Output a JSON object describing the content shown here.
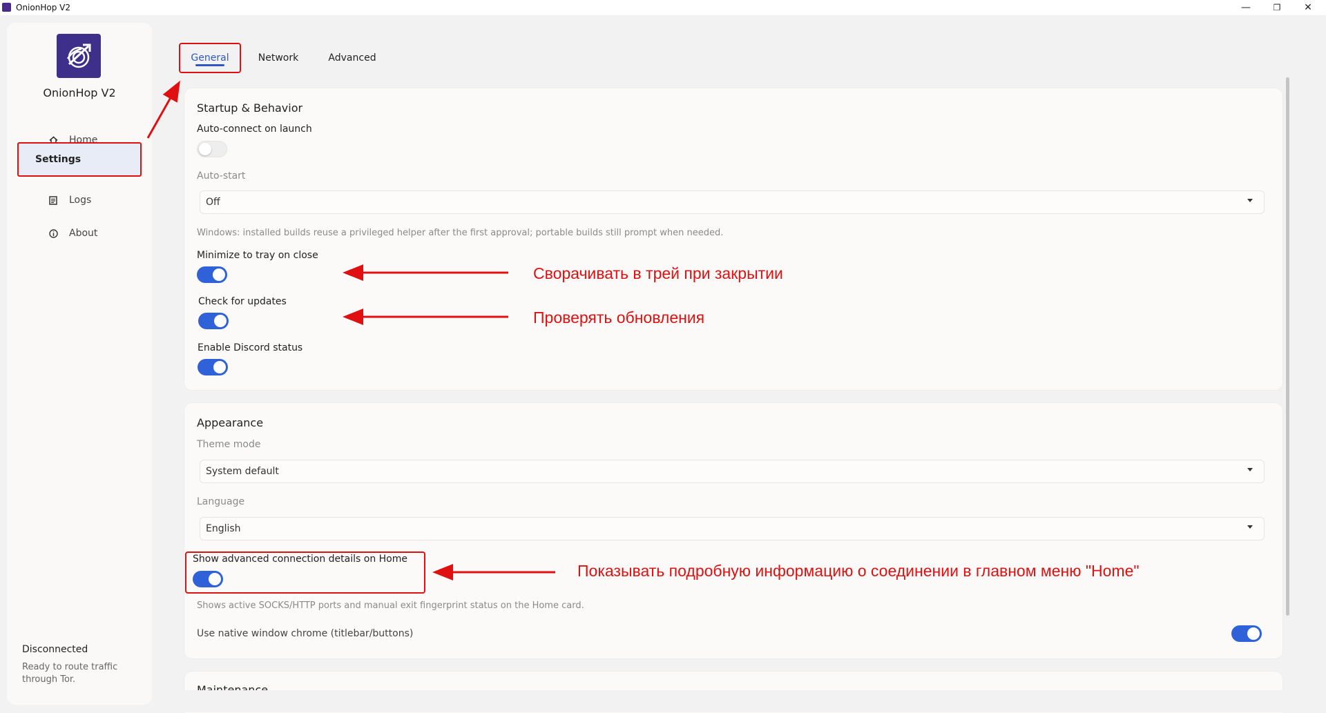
{
  "window": {
    "title": "OnionHop V2",
    "minimize": "—",
    "restore": "❐",
    "close": "✕"
  },
  "sidebar": {
    "brand": "OnionHop V2",
    "items": [
      {
        "label": "Home",
        "icon": "home-icon"
      },
      {
        "label": "Settings",
        "icon": ""
      },
      {
        "label": "Logs",
        "icon": "logs-icon"
      },
      {
        "label": "About",
        "icon": "info-icon"
      }
    ],
    "status_title": "Disconnected",
    "status_text": "Ready to route traffic through Tor."
  },
  "tabs": [
    {
      "label": "General",
      "active": true
    },
    {
      "label": "Network",
      "active": false
    },
    {
      "label": "Advanced",
      "active": false
    }
  ],
  "startup": {
    "title": "Startup & Behavior",
    "autoconnect_label": "Auto-connect on launch",
    "autoconnect_on": false,
    "autostart_label": "Auto-start",
    "autostart_value": "Off",
    "windows_hint": "Windows: installed builds reuse a privileged helper after the first approval; portable builds still prompt when needed.",
    "tray_label": "Minimize to tray on close",
    "tray_on": true,
    "updates_label": "Check for updates",
    "updates_on": true,
    "discord_label": "Enable Discord status",
    "discord_on": true
  },
  "appearance": {
    "title": "Appearance",
    "theme_label": "Theme mode",
    "theme_value": "System default",
    "language_label": "Language",
    "language_value": "English",
    "advanced_label": "Show advanced connection details on Home",
    "advanced_on": true,
    "advanced_hint": "Shows active SOCKS/HTTP ports and manual exit fingerprint status on the Home card.",
    "native_label": "Use native window chrome (titlebar/buttons)",
    "native_on": true
  },
  "maintenance": {
    "title": "Maintenance"
  },
  "annotations": {
    "tray_note": "Сворачивать в трей при закрытии",
    "updates_note": "Проверять обновления",
    "advanced_note": "Показывать подробную информацию о соединении в главном меню \"Home\""
  },
  "colors": {
    "accent": "#2f62d8",
    "annotation": "#e01010",
    "logo_bg": "#3e2f8a"
  }
}
